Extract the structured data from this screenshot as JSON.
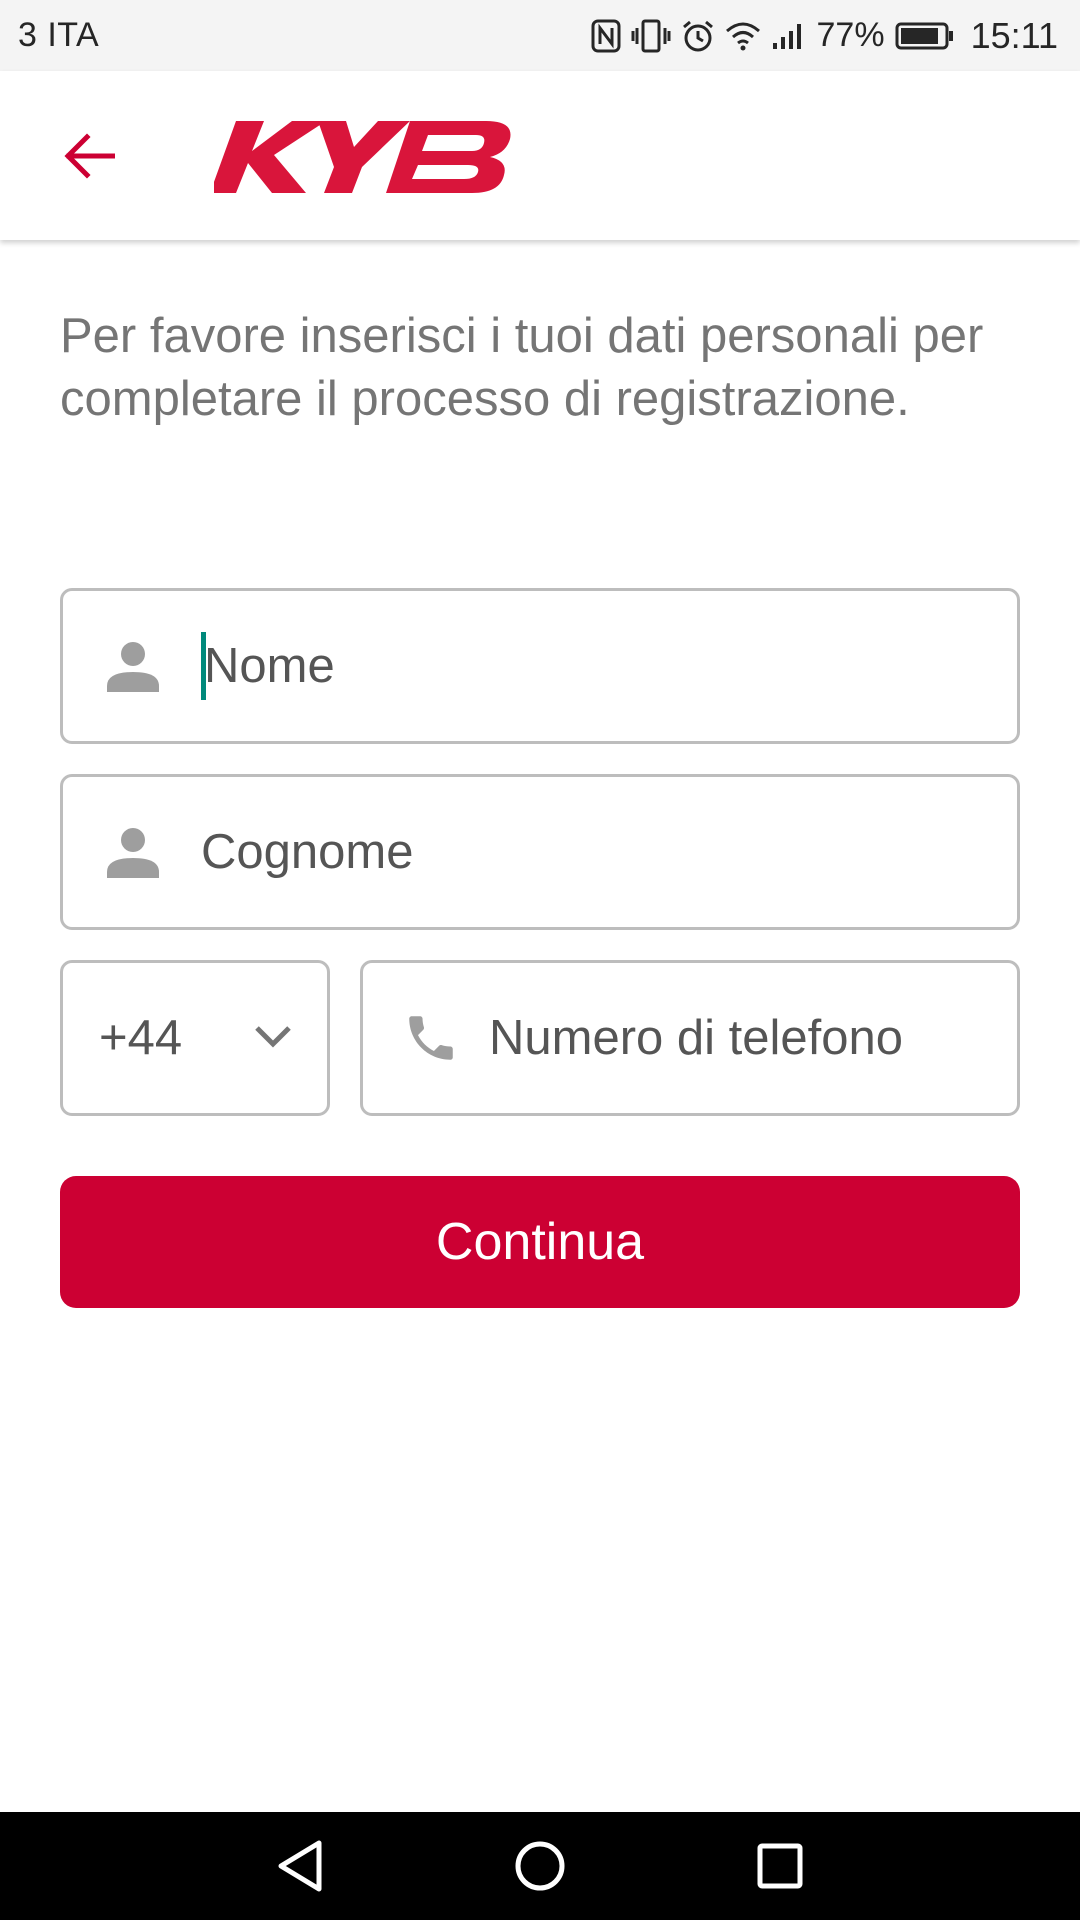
{
  "status_bar": {
    "carrier": "3 ITA",
    "battery_percent": "77%",
    "time": "15:11",
    "icons": [
      "nfc-icon",
      "vibrate-icon",
      "alarm-icon",
      "wifi-icon",
      "signal-icon",
      "battery-icon"
    ]
  },
  "app_bar": {
    "back_icon": "arrow-back-icon",
    "logo_text": "KYB",
    "accent_color": "#cc0033"
  },
  "form": {
    "intro_text": "Per favore inserisci i tuoi dati personali per completare il processo di registrazione.",
    "first_name": {
      "placeholder": "Nome",
      "value": "",
      "icon": "person-icon"
    },
    "last_name": {
      "placeholder": "Cognome",
      "value": "",
      "icon": "person-icon"
    },
    "country_code": {
      "value": "+44",
      "icon": "chevron-down-icon"
    },
    "phone": {
      "placeholder": "Numero di telefono",
      "value": "",
      "icon": "phone-icon"
    },
    "continue_label": "Continua",
    "button_color": "#cc0033"
  },
  "nav_bar": {
    "back": "triangle-back-icon",
    "home": "circle-home-icon",
    "recents": "square-recents-icon"
  }
}
